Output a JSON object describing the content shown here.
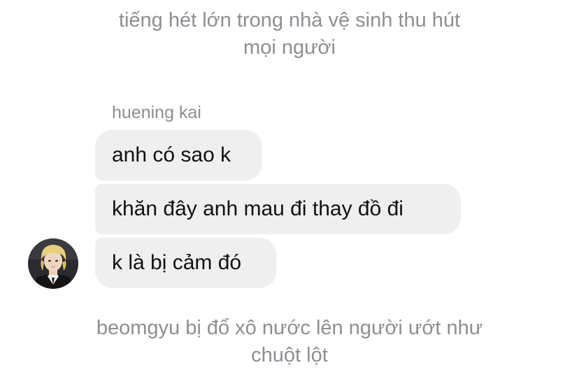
{
  "system_top": {
    "line1": "tiếng hét lớn trong nhà vệ sinh thu hút",
    "line2": "mọi người"
  },
  "sender": {
    "name": "huening kai"
  },
  "messages": [
    {
      "text": "anh có sao k"
    },
    {
      "text": "khăn đây anh mau đi thay đồ đi"
    },
    {
      "text": "k là bị cảm đó"
    }
  ],
  "system_bottom": {
    "line1": "beomgyu bị đổ xô nước lên người ướt như",
    "line2": "chuột lột"
  },
  "colors": {
    "system_text": "#8e8e93",
    "bubble_bg": "#efefef",
    "message_text": "#111111"
  }
}
